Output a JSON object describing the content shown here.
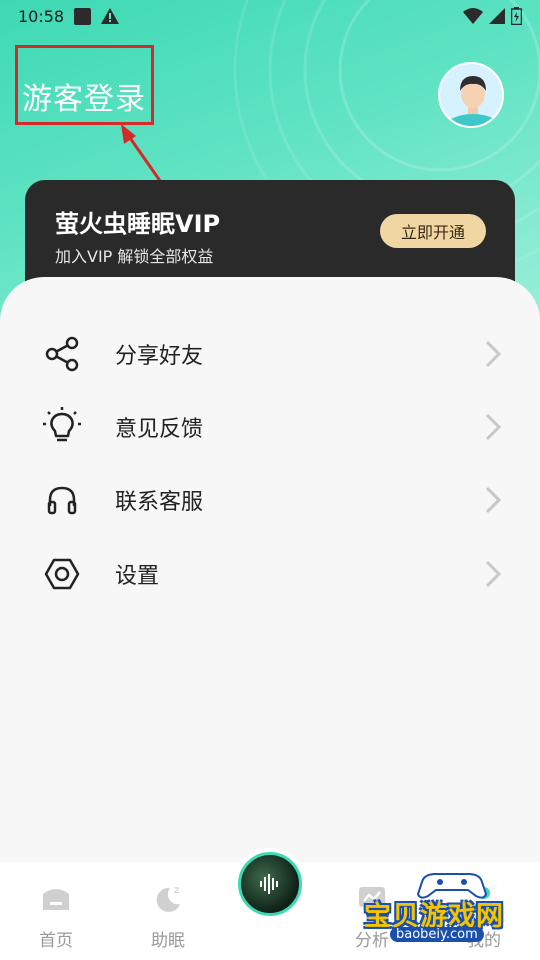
{
  "status_bar": {
    "time": "10:58",
    "icons": [
      "square-notification-icon",
      "warning-icon",
      "wifi-icon",
      "signal-icon",
      "battery-icon"
    ]
  },
  "header": {
    "guest_login": "游客登录",
    "annotation_color": "#d42a2a"
  },
  "vip": {
    "title": "萤火虫睡眠VIP",
    "subtitle": "加入VIP 解锁全部权益",
    "button": "立即开通"
  },
  "menu": {
    "items": [
      {
        "label": "分享好友",
        "icon": "share-icon"
      },
      {
        "label": "意见反馈",
        "icon": "lightbulb-icon"
      },
      {
        "label": "联系客服",
        "icon": "headphones-icon"
      },
      {
        "label": "设置",
        "icon": "settings-hexagon-icon"
      }
    ]
  },
  "bottom_nav": {
    "items": [
      {
        "label": "首页",
        "icon": "home-icon"
      },
      {
        "label": "助眠",
        "icon": "moon-zz-icon"
      },
      {
        "label": "",
        "icon": "sound-disc-icon"
      },
      {
        "label": "分析",
        "icon": "analysis-icon"
      },
      {
        "label": "我的",
        "icon": "profile-icon"
      }
    ]
  },
  "watermark": {
    "text": "宝贝游戏网",
    "url": "baobeiy.com"
  },
  "colors": {
    "accent": "#3ed9b4",
    "vip_card": "#2a2a2a",
    "vip_button": "#f0d6a2"
  }
}
